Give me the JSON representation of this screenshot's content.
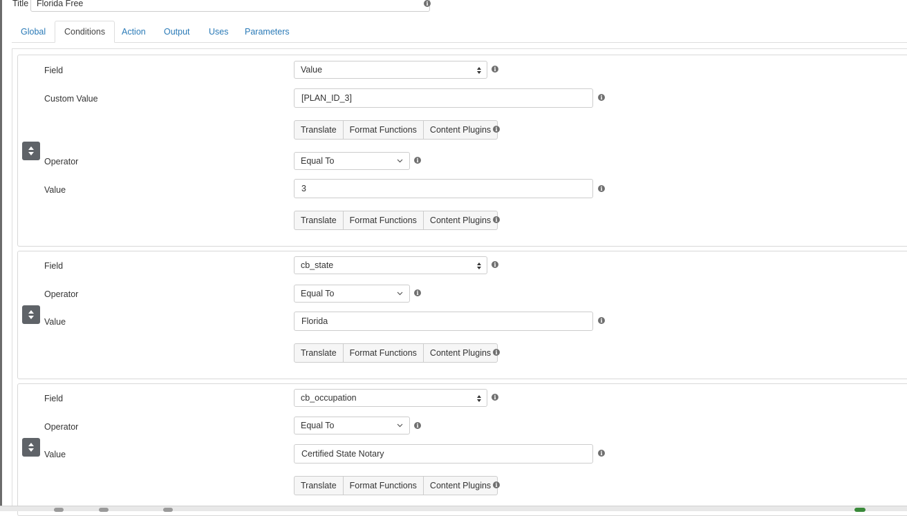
{
  "header": {
    "title_label": "Title",
    "title_value": "Florida Free"
  },
  "tabs": [
    {
      "label": "Global",
      "active": false
    },
    {
      "label": "Conditions",
      "active": true
    },
    {
      "label": "Action",
      "active": false
    },
    {
      "label": "Output",
      "active": false
    },
    {
      "label": "Uses",
      "active": false
    },
    {
      "label": "Parameters",
      "active": false
    }
  ],
  "buttons": {
    "translate": "Translate",
    "format_functions": "Format Functions",
    "content_plugins": "Content Plugins"
  },
  "conditions": [
    {
      "field_label": "Field",
      "field_value": "Value",
      "custom_value_label": "Custom Value",
      "custom_value": "[PLAN_ID_3]",
      "operator_label": "Operator",
      "operator_value": "Equal To",
      "value_label": "Value",
      "value": "3"
    },
    {
      "field_label": "Field",
      "field_value": "cb_state",
      "operator_label": "Operator",
      "operator_value": "Equal To",
      "value_label": "Value",
      "value": "Florida"
    },
    {
      "field_label": "Field",
      "field_value": "cb_occupation",
      "operator_label": "Operator",
      "operator_value": "Equal To",
      "value_label": "Value",
      "value": "Certified State Notary"
    }
  ],
  "icons": {
    "info": "info-icon",
    "sort": "sort-arrows-icon",
    "chevron": "chevron-down-icon"
  },
  "colors": {
    "link": "#2a7ab7",
    "handle": "#5f6368",
    "border": "#cccccc"
  }
}
